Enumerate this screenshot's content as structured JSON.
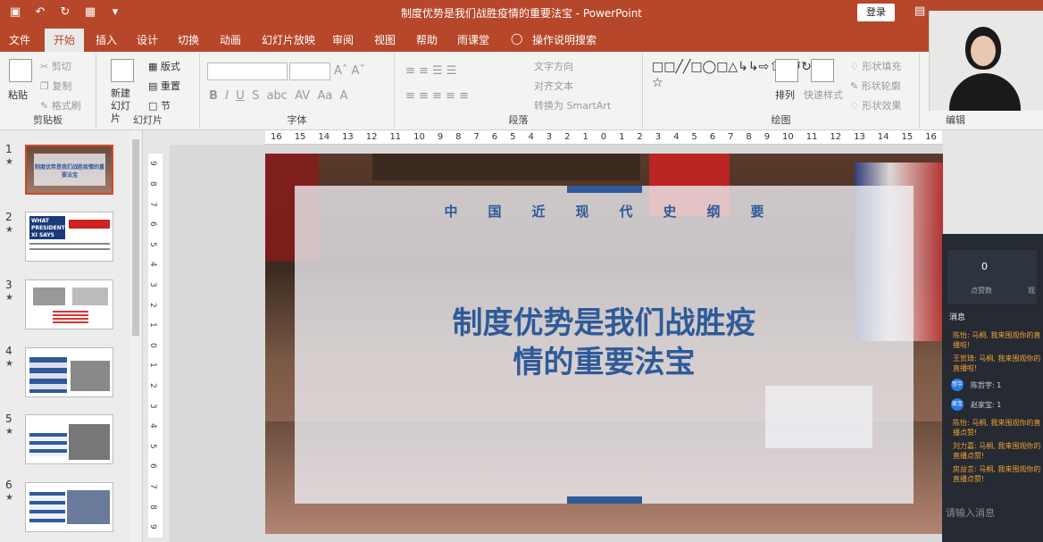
{
  "window": {
    "title": "制度优势是我们战胜疫情的重要法宝 - PowerPoint",
    "login_label": "登录"
  },
  "tabs": [
    "文件",
    "开始",
    "插入",
    "设计",
    "切换",
    "动画",
    "幻灯片放映",
    "审阅",
    "视图",
    "帮助",
    "雨课堂",
    "操作说明搜索"
  ],
  "active_tab": "开始",
  "ribbon": {
    "clipboard": {
      "paste": "粘贴",
      "cut": "剪切",
      "copy": "复制",
      "format_painter": "格式刷",
      "label": "剪贴板"
    },
    "slides": {
      "new_slide": "新建幻灯片",
      "layout": "版式",
      "reset": "重置",
      "section": "节",
      "label": "幻灯片"
    },
    "font": {
      "label": "字体"
    },
    "paragraph": {
      "text_direction": "文字方向",
      "align_text": "对齐文本",
      "convert_smartart": "转换为 SmartArt",
      "label": "段落"
    },
    "drawing": {
      "arrange": "排列",
      "quick_styles": "快速样式",
      "shape_fill": "形状填充",
      "shape_outline": "形状轮廓",
      "shape_effects": "形状效果",
      "label": "绘图"
    },
    "editing": {
      "label": "编辑"
    }
  },
  "ruler": {
    "horizontal": [
      "16",
      "15",
      "14",
      "13",
      "12",
      "11",
      "10",
      "9",
      "8",
      "7",
      "6",
      "5",
      "4",
      "3",
      "2",
      "1",
      "0",
      "1",
      "2",
      "3",
      "4",
      "5",
      "6",
      "7",
      "8",
      "9",
      "10",
      "11",
      "12",
      "13",
      "14",
      "15",
      "16"
    ],
    "vertical": [
      "9",
      "8",
      "7",
      "6",
      "5",
      "4",
      "3",
      "2",
      "1",
      "0",
      "1",
      "2",
      "3",
      "4",
      "5",
      "6",
      "7",
      "8",
      "9"
    ]
  },
  "thumbnails": [
    {
      "num": "1",
      "text": "制度优势是我们战胜疫情的重要法宝"
    },
    {
      "num": "2",
      "text": "WHAT PRESIDENT XI SAYS"
    },
    {
      "num": "3",
      "text": ""
    },
    {
      "num": "4",
      "text": ""
    },
    {
      "num": "5",
      "text": ""
    },
    {
      "num": "6",
      "text": ""
    }
  ],
  "slide": {
    "subtitle": "中国近现代史纲要",
    "title_line1": "制度优势是我们战胜疫",
    "title_line2": "情的重要法宝"
  },
  "chat": {
    "stat_value": "0",
    "stat_label": "点赞数",
    "stat_label2": "观",
    "header": "消息",
    "messages": [
      {
        "text": "陈怡: 马桐, 我来围观你的直播啦!",
        "color": "orange"
      },
      {
        "text": "王贺琦: 马桐, 我来围观你的直播啦!",
        "color": "orange"
      },
      {
        "text": "陈哲宇: 1",
        "color": "gray",
        "avatar": "哲宇"
      },
      {
        "text": "赵家宝: 1",
        "color": "gray",
        "avatar": "家宝"
      },
      {
        "text": "陈怡: 马桐, 我来围观你的直播点赞!",
        "color": "orange"
      },
      {
        "text": "刘力嘉: 马桐, 我来围观你的直播点赞!",
        "color": "orange"
      },
      {
        "text": "房益言: 马桐, 我来围观你的直播点赞!",
        "color": "orange"
      }
    ],
    "input_placeholder": "请输入消息"
  },
  "colors": {
    "accent": "#b7472a",
    "slide_blue": "#2e5a9a"
  }
}
